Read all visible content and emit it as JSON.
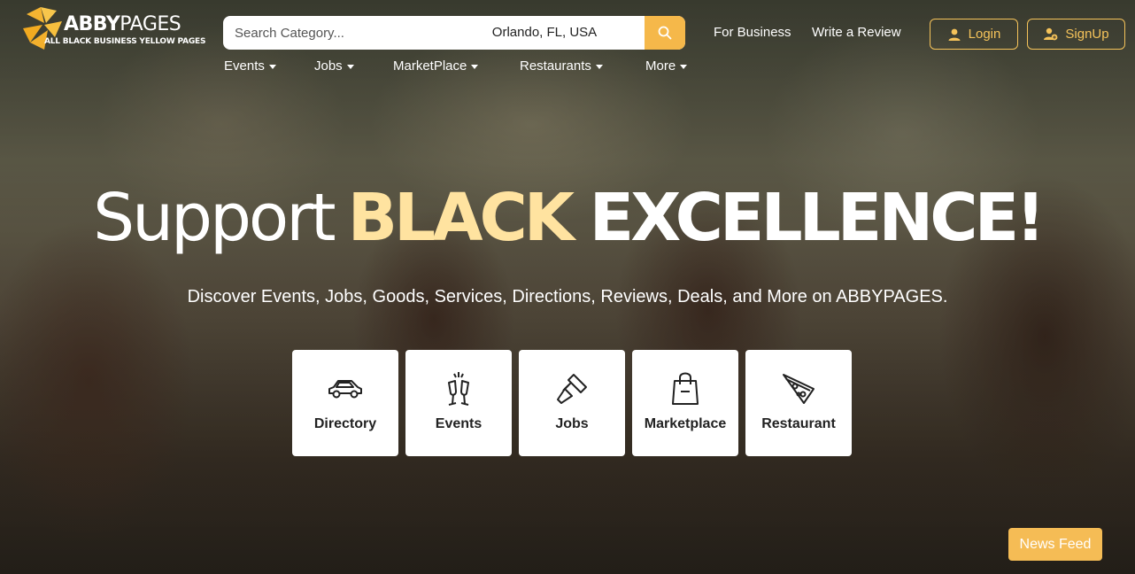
{
  "brand": {
    "name_bold": "ABBY",
    "name_thin": "PAGES",
    "tagline": "ALL BLACK BUSINESS YELLOW PAGES",
    "accent_color": "#f5b84a"
  },
  "search": {
    "placeholder": "Search Category...",
    "location": "Orlando, FL, USA",
    "icon": "search-icon"
  },
  "header_links": {
    "for_business": "For Business",
    "write_review": "Write a Review",
    "login": "Login",
    "signup": "SignUp"
  },
  "nav": [
    "Events",
    "Jobs",
    "MarketPlace",
    "Restaurants",
    "More"
  ],
  "hero": {
    "headline_light": "Support",
    "headline_gold": "BLACK",
    "headline_bold": "EXCELLENCE!",
    "subline": "Discover Events, Jobs, Goods, Services, Directions, Reviews, Deals, and More on ABBYPAGES."
  },
  "categories": [
    {
      "label": "Directory",
      "icon": "car-icon"
    },
    {
      "label": "Events",
      "icon": "cheers-icon"
    },
    {
      "label": "Jobs",
      "icon": "paint-scraper-icon"
    },
    {
      "label": "Marketplace",
      "icon": "shopping-bag-icon"
    },
    {
      "label": "Restaurant",
      "icon": "pizza-icon"
    }
  ],
  "news_feed": "News Feed"
}
